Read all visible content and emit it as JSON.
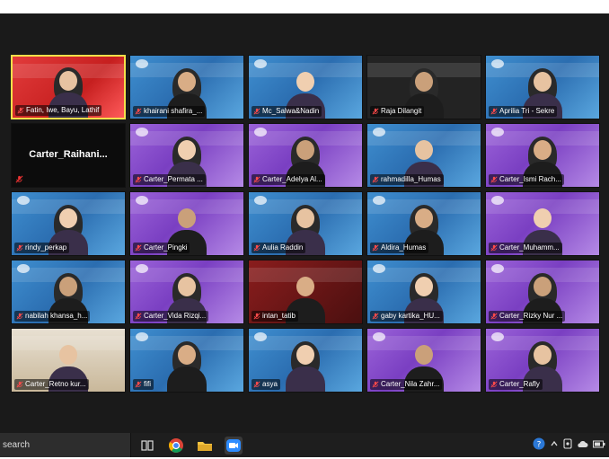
{
  "taskbar": {
    "search_placeholder": "search",
    "pinned_apps": [
      {
        "name": "task-view-icon"
      },
      {
        "name": "chrome-icon"
      },
      {
        "name": "file-explorer-icon"
      },
      {
        "name": "zoom-icon"
      }
    ],
    "tray": [
      "help-icon",
      "chevron-up-icon",
      "camera-icon",
      "cloud-icon",
      "battery-icon"
    ]
  },
  "participants": [
    {
      "name": "Fatin, Iwe, Bayu, Lathif",
      "bg": "red",
      "active": true
    },
    {
      "name": "khairani shafira_...",
      "bg": "blue"
    },
    {
      "name": "Mc_Salwa&Nadin",
      "bg": "blue"
    },
    {
      "name": "Raja Dilangit",
      "bg": "dark"
    },
    {
      "name": "Aprilia Tri - Sekre",
      "bg": "blue"
    },
    {
      "name": "Carter_Raihani...",
      "bg": "black",
      "video_off": true
    },
    {
      "name": "Carter_Permata ...",
      "bg": "purple"
    },
    {
      "name": "Carter_Adelya Al...",
      "bg": "purple"
    },
    {
      "name": "rahmadilla_Humas",
      "bg": "blue"
    },
    {
      "name": "Carter_Ismi Rach...",
      "bg": "purple"
    },
    {
      "name": "rindy_perkap",
      "bg": "blue"
    },
    {
      "name": "Carter_Pingki",
      "bg": "purple"
    },
    {
      "name": "Aulia Raddin",
      "bg": "blue"
    },
    {
      "name": "Aldira_Humas",
      "bg": "blue"
    },
    {
      "name": "Carter_Muhamm...",
      "bg": "purple"
    },
    {
      "name": "nabilah khansa_h...",
      "bg": "blue"
    },
    {
      "name": "Carter_Vida Rizqi...",
      "bg": "purple"
    },
    {
      "name": "intan_tatib",
      "bg": "darkred"
    },
    {
      "name": "gaby kartika_HU...",
      "bg": "blue"
    },
    {
      "name": "Carter_Rizky Nur ...",
      "bg": "purple"
    },
    {
      "name": "Carter_Retno kur...",
      "bg": "room"
    },
    {
      "name": "fifi",
      "bg": "blue"
    },
    {
      "name": "asya",
      "bg": "blue"
    },
    {
      "name": "Carter_Nila Zahr...",
      "bg": "purple"
    },
    {
      "name": "Carter_Rafly",
      "bg": "purple"
    }
  ]
}
